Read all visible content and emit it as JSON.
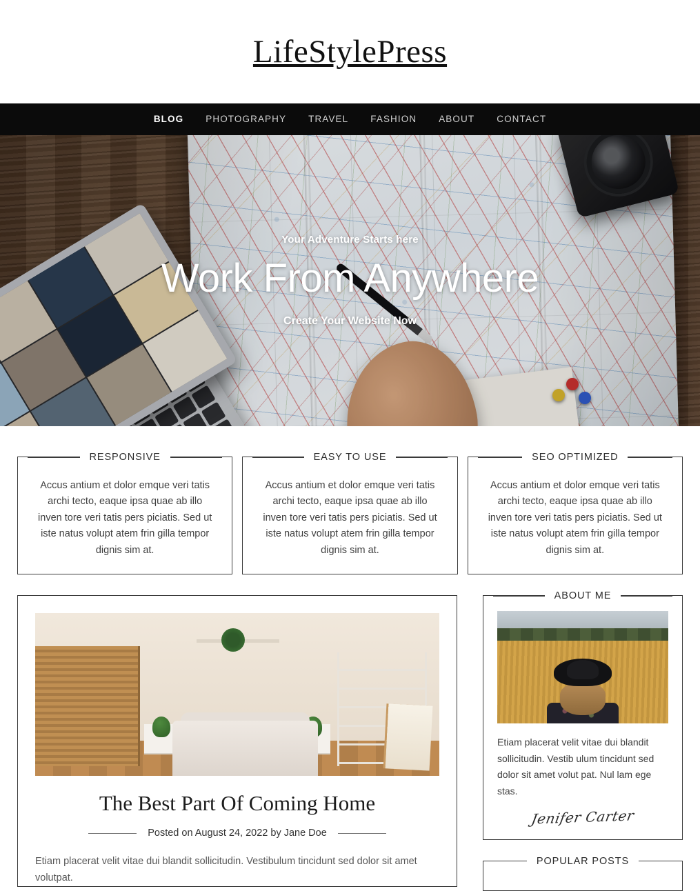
{
  "site": {
    "title": "LifeStylePress"
  },
  "nav": {
    "items": [
      {
        "label": "BLOG",
        "active": true
      },
      {
        "label": "PHOTOGRAPHY",
        "active": false
      },
      {
        "label": "TRAVEL",
        "active": false
      },
      {
        "label": "FASHION",
        "active": false
      },
      {
        "label": "ABOUT",
        "active": false
      },
      {
        "label": "CONTACT",
        "active": false
      }
    ]
  },
  "hero": {
    "eyebrow": "Your Adventure Starts here",
    "title": "Work From Anywhere",
    "cta": "Create Your Website Now"
  },
  "features": [
    {
      "title": "RESPONSIVE",
      "body": "Accus antium et dolor emque veri tatis archi tecto, eaque ipsa quae ab illo inven tore veri tatis pers piciatis. Sed ut iste natus volupt atem frin gilla tempor dignis sim at."
    },
    {
      "title": "EASY TO USE",
      "body": "Accus antium et dolor emque veri tatis archi tecto, eaque ipsa quae ab illo inven tore veri tatis pers piciatis. Sed ut iste natus volupt atem frin gilla tempor dignis sim at."
    },
    {
      "title": "SEO OPTIMIZED",
      "body": "Accus antium et dolor emque veri tatis archi tecto, eaque ipsa quae ab illo inven tore veri tatis pers piciatis. Sed ut iste natus volupt atem frin gilla tempor dignis sim at."
    }
  ],
  "post": {
    "title": "The Best Part Of Coming Home",
    "meta": "Posted on August 24, 2022 by Jane Doe",
    "excerpt": "Etiam placerat velit vitae dui blandit sollicitudin. Vestibulum tincidunt sed dolor sit amet volutpat."
  },
  "sidebar": {
    "about": {
      "title": "ABOUT ME",
      "text": "Etiam placerat velit vitae dui blandit sollicitudin. Vestib ulum tincidunt sed dolor sit amet volut pat. Nul lam ege stas.",
      "signature": "Jenifer Carter"
    },
    "popular": {
      "title": "POPULAR POSTS"
    }
  },
  "colors": {
    "nav_background": "#0b0b0b",
    "border": "#3a3a3a",
    "text": "#333333",
    "muted_text": "#575757"
  }
}
